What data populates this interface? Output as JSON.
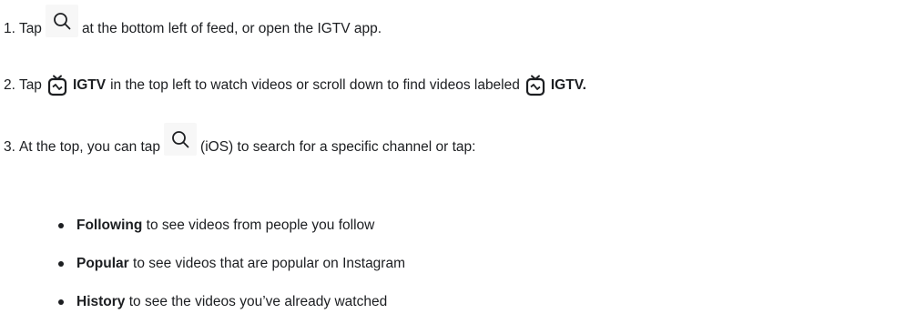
{
  "steps": [
    {
      "number": "1.",
      "before": "Tap",
      "after": "at the bottom left of feed, or open the IGTV app."
    },
    {
      "number": "2.",
      "before": "Tap",
      "bold1": "IGTV",
      "middle": "in the top left to watch videos or scroll down to find videos labeled",
      "bold2": "IGTV."
    },
    {
      "number": "3.",
      "before": "At the top, you can tap",
      "after": "(iOS) to search for a specific channel or tap:"
    }
  ],
  "bullets": [
    {
      "bold": "Following",
      "text": " to see videos from people you follow"
    },
    {
      "bold": "Popular",
      "text": " to see videos that are popular on Instagram"
    },
    {
      "bold": "History",
      "text": " to see the videos you’ve already watched"
    }
  ],
  "icons": {
    "search": "search-icon",
    "igtv": "igtv-icon"
  },
  "colors": {
    "text": "#1c1e21",
    "icon_background": "#f7f7f7"
  }
}
